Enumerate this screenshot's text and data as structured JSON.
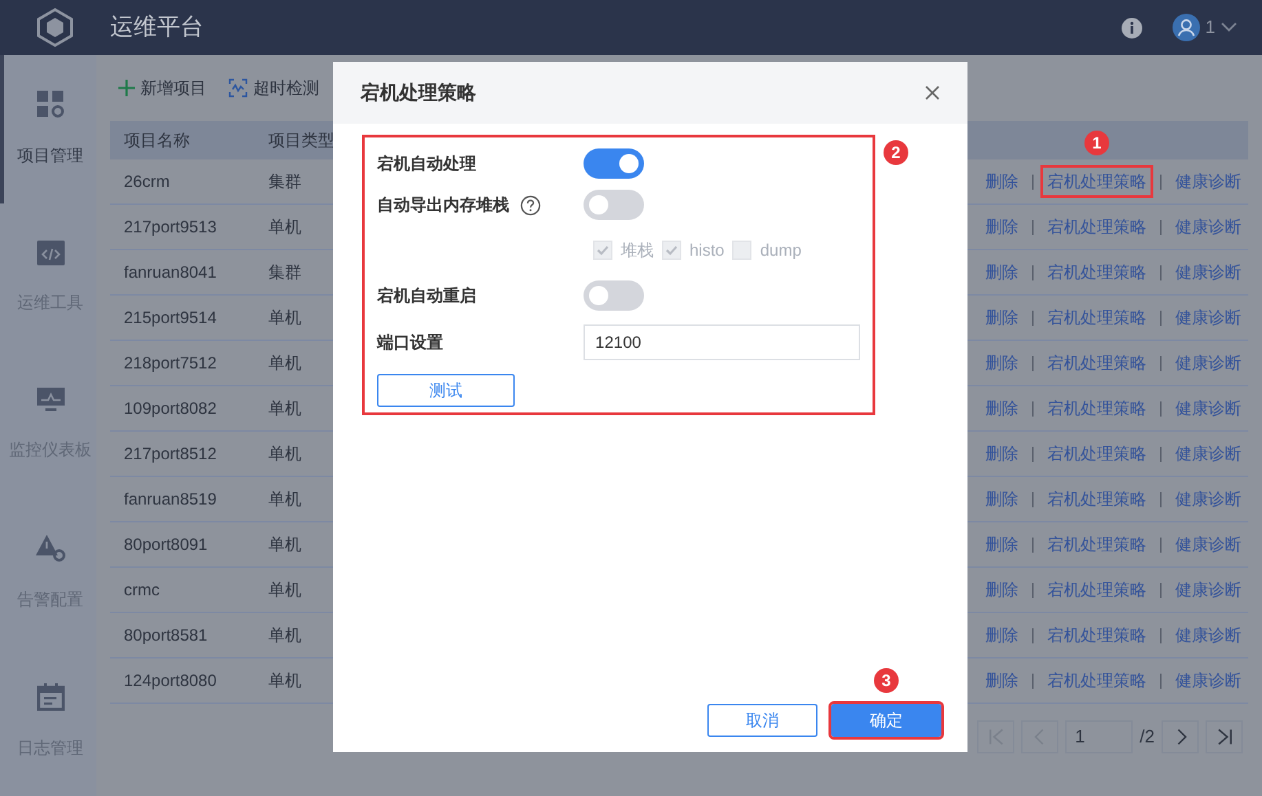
{
  "header": {
    "title": "运维平台",
    "user": "1"
  },
  "sidebar": {
    "items": [
      {
        "label": "项目管理",
        "selected": true
      },
      {
        "label": "运维工具",
        "selected": false
      },
      {
        "label": "监控仪表板",
        "selected": false
      },
      {
        "label": "告警配置",
        "selected": false
      },
      {
        "label": "日志管理",
        "selected": false
      }
    ]
  },
  "toolbar": [
    {
      "label": "新增项目"
    },
    {
      "label": "超时检测"
    }
  ],
  "table": {
    "columns": [
      "项目名称",
      "项目类型"
    ],
    "rows": [
      {
        "name": "26crm",
        "type": "集群",
        "actions": [
          {
            "label": "删除"
          },
          {
            "label": "宕机处理策略",
            "callout": "1"
          },
          {
            "label": "健康诊断"
          }
        ]
      },
      {
        "name": "217port9513",
        "type": "单机",
        "actions": [
          {
            "label": "删除"
          },
          {
            "label": "宕机处理策略"
          },
          {
            "label": "健康诊断"
          }
        ]
      },
      {
        "name": "fanruan8041",
        "type": "集群",
        "actions": [
          {
            "label": "删除"
          },
          {
            "label": "宕机处理策略"
          },
          {
            "label": "健康诊断"
          }
        ]
      },
      {
        "name": "215port9514",
        "type": "单机",
        "actions": [
          {
            "label": "删除"
          },
          {
            "label": "宕机处理策略"
          },
          {
            "label": "健康诊断"
          }
        ]
      },
      {
        "name": "218port7512",
        "type": "单机",
        "actions": [
          {
            "label": "删除"
          },
          {
            "label": "宕机处理策略"
          },
          {
            "label": "健康诊断"
          }
        ]
      },
      {
        "name": "109port8082",
        "type": "单机",
        "actions": [
          {
            "label": "删除"
          },
          {
            "label": "宕机处理策略"
          },
          {
            "label": "健康诊断"
          }
        ]
      },
      {
        "name": "217port8512",
        "type": "单机",
        "actions": [
          {
            "label": "删除"
          },
          {
            "label": "宕机处理策略"
          },
          {
            "label": "健康诊断"
          }
        ]
      },
      {
        "name": "fanruan8519",
        "type": "单机",
        "actions": [
          {
            "label": "删除"
          },
          {
            "label": "宕机处理策略"
          },
          {
            "label": "健康诊断"
          }
        ]
      },
      {
        "name": "80port8091",
        "type": "单机",
        "actions": [
          {
            "label": "删除"
          },
          {
            "label": "宕机处理策略"
          },
          {
            "label": "健康诊断"
          }
        ]
      },
      {
        "name": "crmc",
        "type": "单机",
        "actions": [
          {
            "label": "删除"
          },
          {
            "label": "宕机处理策略"
          },
          {
            "label": "健康诊断"
          }
        ]
      },
      {
        "name": "80port8581",
        "type": "单机",
        "actions": [
          {
            "label": "删除"
          },
          {
            "label": "宕机处理策略"
          },
          {
            "label": "健康诊断"
          }
        ]
      },
      {
        "name": "124port8080",
        "type": "单机",
        "actions": [
          {
            "label": "删除"
          },
          {
            "label": "宕机处理策略"
          },
          {
            "label": "健康诊断"
          }
        ]
      }
    ]
  },
  "pagination": {
    "page": "1",
    "total": "/2",
    "first_disabled": true,
    "prev_disabled": true
  },
  "dialog": {
    "title": "宕机处理策略",
    "callout": "2",
    "fields": [
      {
        "kind": "switch",
        "label": "宕机自动处理",
        "on": true
      },
      {
        "kind": "switch",
        "label": "自动导出内存堆栈",
        "on": false,
        "help": true
      },
      {
        "kind": "checkboxes",
        "options": [
          {
            "label": "堆栈",
            "checked": true,
            "disabled": true
          },
          {
            "label": "histo",
            "checked": true,
            "disabled": true
          },
          {
            "label": "dump",
            "checked": false,
            "disabled": true
          }
        ]
      },
      {
        "kind": "switch",
        "label": "宕机自动重启",
        "on": false
      },
      {
        "kind": "input",
        "label": "端口设置",
        "value": "12100"
      },
      {
        "kind": "button",
        "label": "测试"
      }
    ],
    "buttons": [
      {
        "label": "取消",
        "primary": false
      },
      {
        "label": "确定",
        "primary": true,
        "callout": "3"
      }
    ]
  }
}
